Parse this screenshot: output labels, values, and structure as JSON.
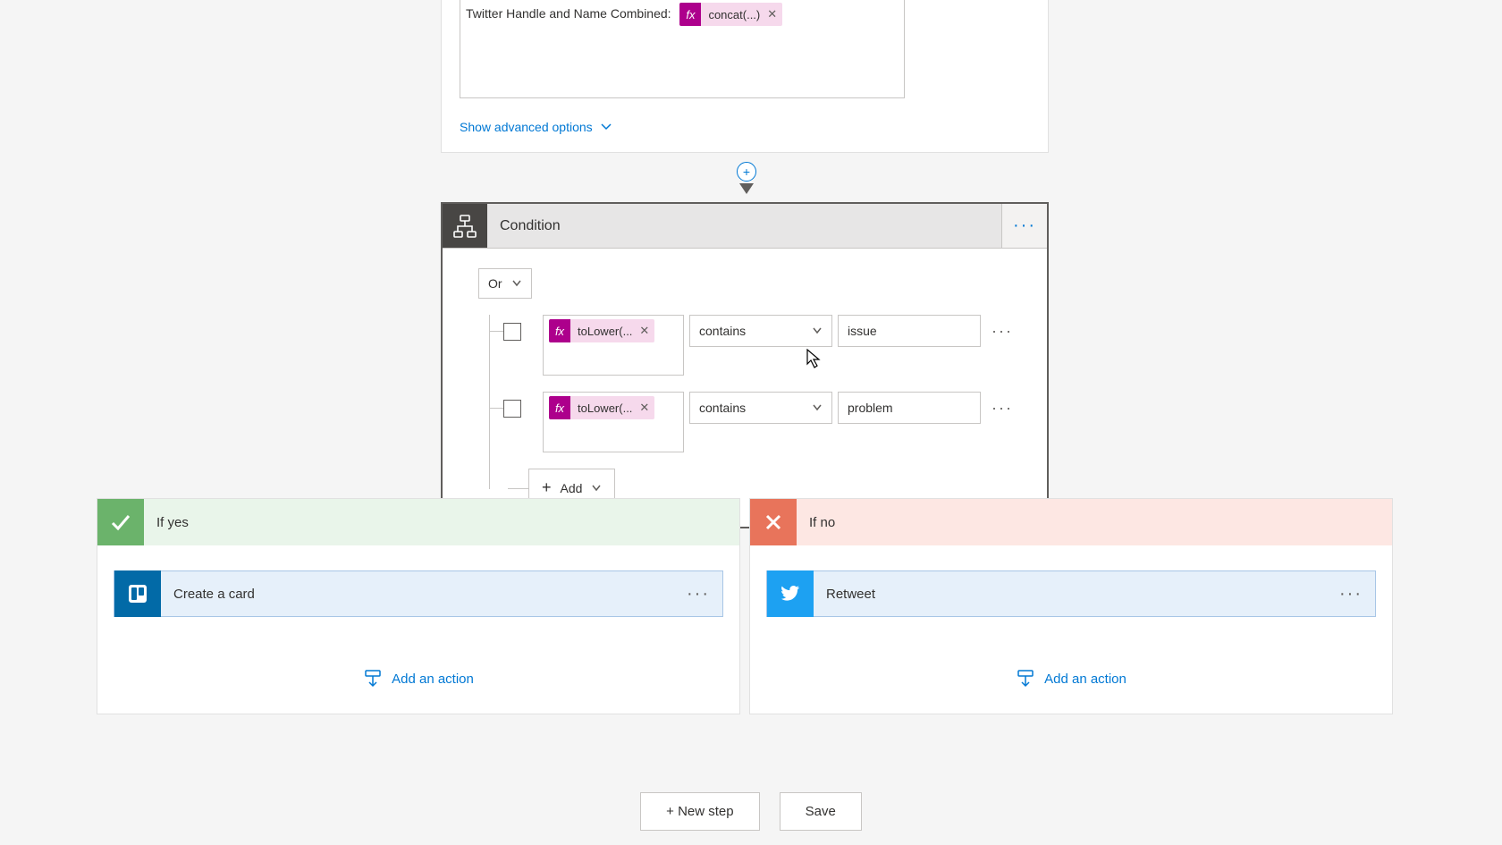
{
  "top": {
    "field_label": "Twitter Handle and Name Combined:",
    "token_label": "concat(...)",
    "adv_link": "Show advanced options"
  },
  "condition": {
    "title": "Condition",
    "logic": "Or",
    "rules": [
      {
        "expr": "toLower(...",
        "op": "contains",
        "value": "issue"
      },
      {
        "expr": "toLower(...",
        "op": "contains",
        "value": "problem"
      }
    ],
    "add_label": "Add"
  },
  "branches": {
    "yes": {
      "label": "If yes",
      "action_title": "Create a card",
      "add_action": "Add an action"
    },
    "no": {
      "label": "If no",
      "action_title": "Retweet",
      "add_action": "Add an action"
    }
  },
  "footer": {
    "new_step": "+ New step",
    "save": "Save"
  }
}
